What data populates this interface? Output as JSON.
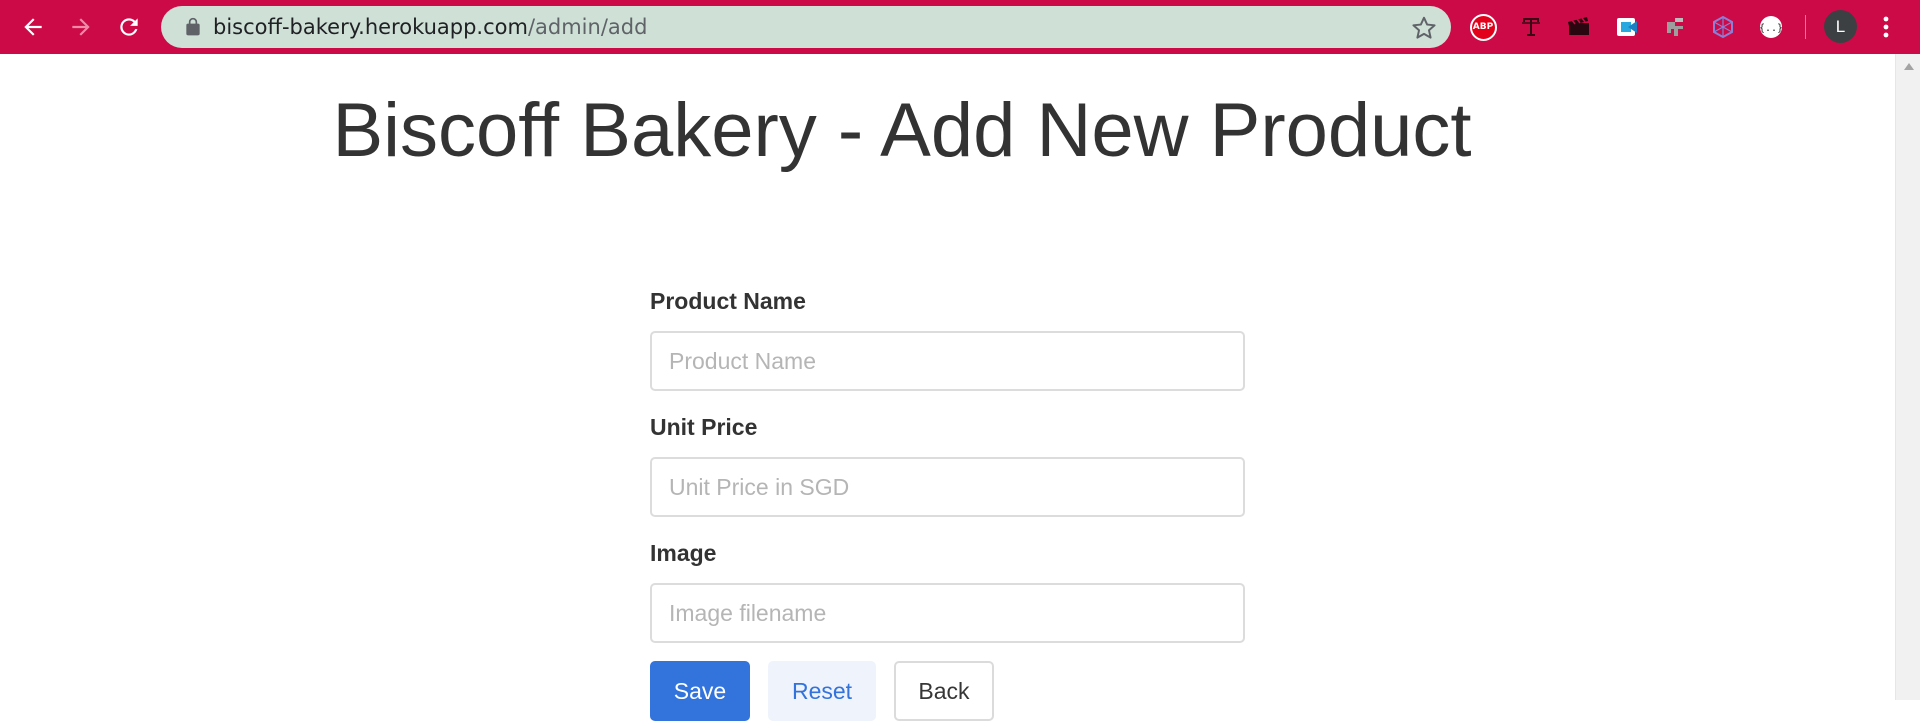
{
  "browser": {
    "url_host": "biscoff-bakery.herokuapp.com",
    "url_path": "/admin/add",
    "extensions": [
      "abp-icon",
      "typewriter-icon",
      "clapper-icon",
      "share-icon",
      "bridge-icon",
      "hexagon-icon",
      "json-icon"
    ],
    "abp_label": "ABP",
    "profile_initial": "L",
    "accent_color": "#cc0a47"
  },
  "page": {
    "title": "Biscoff Bakery - Add New Product"
  },
  "form": {
    "fields": [
      {
        "label": "Product Name",
        "placeholder": "Product Name",
        "value": ""
      },
      {
        "label": "Unit Price",
        "placeholder": "Unit Price in SGD",
        "value": ""
      },
      {
        "label": "Image",
        "placeholder": "Image filename",
        "value": ""
      }
    ],
    "buttons": {
      "save": "Save",
      "reset": "Reset",
      "back": "Back"
    }
  },
  "colors": {
    "primary": "#3273dc",
    "primary_light": "#eef3fc",
    "text": "#333333"
  }
}
